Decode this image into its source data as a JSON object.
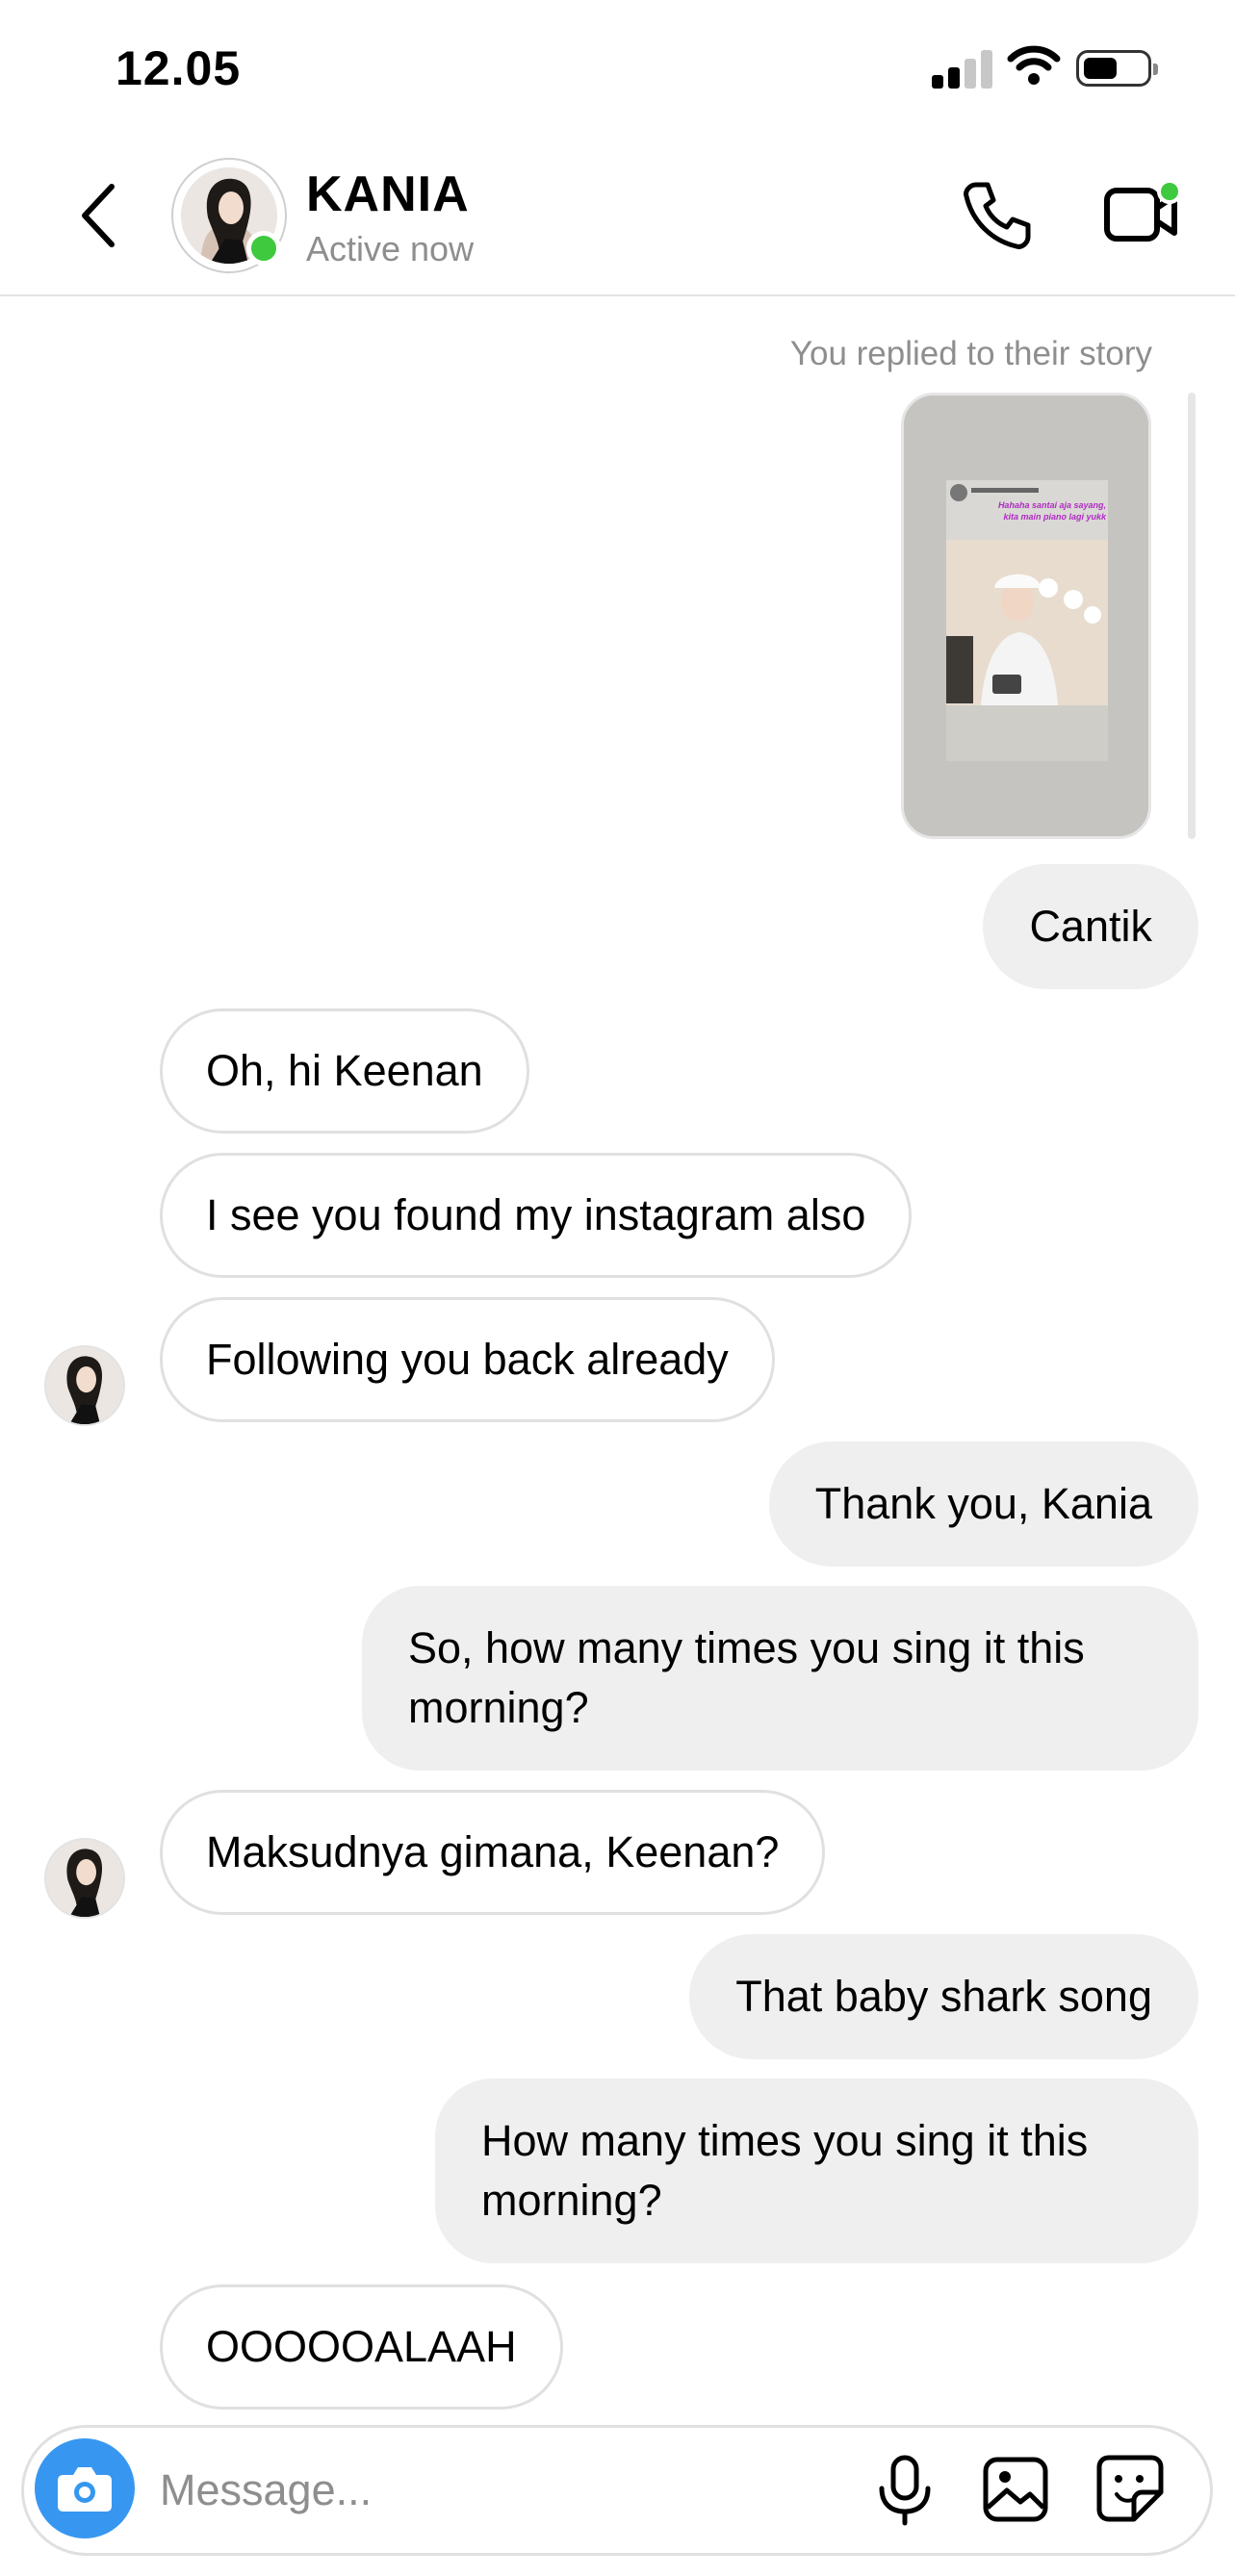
{
  "status_bar": {
    "time": "12.05"
  },
  "header": {
    "contact_name": "KANIA",
    "contact_status": "Active now"
  },
  "chat": {
    "reply_note": "You replied to their story",
    "story_caption": "Hahaha santai aja sayang, kita main piano lagi yukk",
    "messages": [
      {
        "side": "out",
        "text": "Cantik"
      },
      {
        "side": "in",
        "text": "Oh, hi Keenan"
      },
      {
        "side": "in",
        "text": "I see you found my instagram also"
      },
      {
        "side": "in",
        "text": "Following you back already"
      },
      {
        "side": "out",
        "text": "Thank you, Kania"
      },
      {
        "side": "out",
        "text": "So, how many times you sing it this morning?"
      },
      {
        "side": "in",
        "text": "Maksudnya gimana, Keenan?"
      },
      {
        "side": "out",
        "text": "That baby shark song"
      },
      {
        "side": "out",
        "text": "How many times you sing it this morning?"
      },
      {
        "side": "in",
        "text": "OOOOOALAAH"
      }
    ]
  },
  "composer": {
    "placeholder": "Message..."
  },
  "colors": {
    "accent": "#3797f0",
    "online": "#3ec93e",
    "outgoing_bubble": "#efefef"
  }
}
